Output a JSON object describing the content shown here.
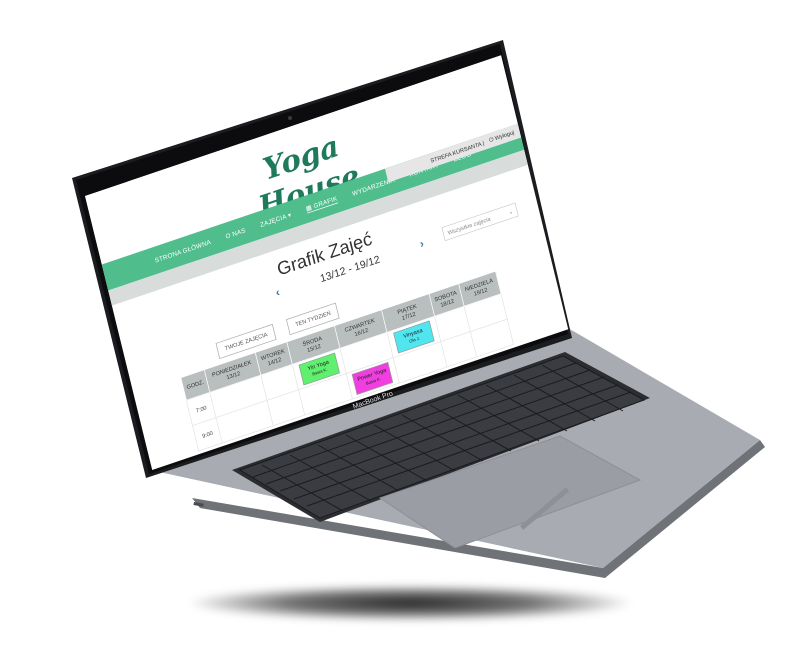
{
  "laptop": {
    "model_label": "MacBook Pro"
  },
  "site": {
    "logo": "Yoga House",
    "nav": [
      {
        "label": "STRONA GŁÓWNA",
        "active": false
      },
      {
        "label": "O NAS",
        "active": false
      },
      {
        "label": "ZAJĘCIA ▾",
        "active": false
      },
      {
        "label": "▦ GRAFIK",
        "active": true
      },
      {
        "label": "WYDARZENIA",
        "active": false
      },
      {
        "label": "KONTAKT",
        "active": false
      },
      {
        "label": "BLOG",
        "active": false
      }
    ],
    "account": {
      "zone_label": "STREFA KURSANTA |",
      "logout_label": "⏻ Wyloguj"
    }
  },
  "schedule": {
    "title": "Grafik Zajęć",
    "week_range": "13/12 - 19/12",
    "prev_icon": "chevron-left-icon",
    "next_icon": "chevron-right-icon",
    "filter_placeholder": "Wszystkie zajęcia",
    "buttons": {
      "your_classes": "TWOJE ZAJĘCIA",
      "this_week": "TEN TYDZIEŃ"
    },
    "columns": [
      {
        "day": "GODZ.",
        "date": ""
      },
      {
        "day": "PONIEDZIAŁEK",
        "date": "13/12"
      },
      {
        "day": "WTOREK",
        "date": "14/12"
      },
      {
        "day": "ŚRODA",
        "date": "15/12"
      },
      {
        "day": "CZWARTEK",
        "date": "16/12"
      },
      {
        "day": "PIĄTEK",
        "date": "17/12"
      },
      {
        "day": "SOBOTA",
        "date": "18/12"
      },
      {
        "day": "NIEDZIELA",
        "date": "19/12"
      }
    ],
    "rows": [
      {
        "time": "7:00"
      },
      {
        "time": "9:00"
      }
    ],
    "events": [
      {
        "name": "Yin Yoga",
        "teacher": "Basia K.",
        "color": "#5ef06e"
      },
      {
        "name": "Power Yoga",
        "teacher": "Basia K.",
        "color": "#f03ee0"
      },
      {
        "name": "Vinyasa",
        "teacher": "Ola J.",
        "color": "#4fe6f0"
      }
    ]
  },
  "colors": {
    "brand_green": "#4fbd8c",
    "logo_green": "#1f7a5c",
    "header_grey": "#b9bfbf"
  }
}
